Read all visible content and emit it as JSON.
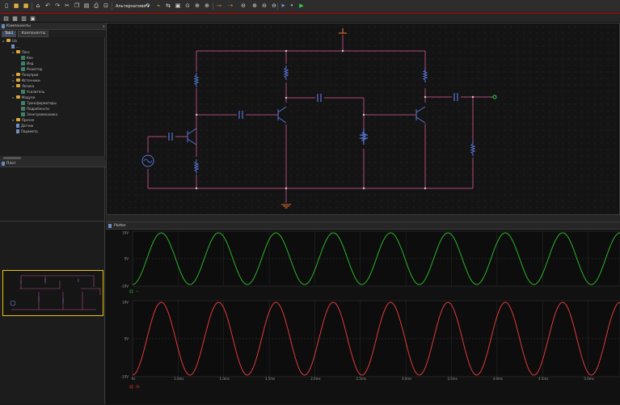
{
  "toolbar": {
    "mode_label": "Альтернатива",
    "icons": [
      "new-file",
      "open-folder",
      "save",
      "save-as",
      "undo",
      "redo",
      "cut",
      "copy",
      "paste",
      "print",
      "zoom-fit",
      "rotate",
      "flip",
      "wire",
      "component",
      "probe",
      "zoom-in",
      "zoom-out",
      "select",
      "run"
    ]
  },
  "left_panel": {
    "title": "Компоненты",
    "tab1": "Tab1",
    "tab2": "Компоненты",
    "tree": [
      {
        "label": "Lib",
        "indent": 0,
        "icon": "folder"
      },
      {
        "label": "...",
        "indent": 1,
        "icon": "file"
      },
      {
        "label": "Пасс",
        "indent": 2,
        "icon": "folder"
      },
      {
        "label": "Кон",
        "indent": 3,
        "icon": "comp"
      },
      {
        "label": "Инд",
        "indent": 3,
        "icon": "comp"
      },
      {
        "label": "Резистор",
        "indent": 3,
        "icon": "comp"
      },
      {
        "label": "Полупров",
        "indent": 2,
        "icon": "folder"
      },
      {
        "label": "Источники",
        "indent": 2,
        "icon": "folder"
      },
      {
        "label": "Логика",
        "indent": 2,
        "icon": "folder"
      },
      {
        "label": "Усилитель",
        "indent": 3,
        "icon": "comp"
      },
      {
        "label": "Модули",
        "indent": 2,
        "icon": "folder"
      },
      {
        "label": "Трансформаторы",
        "indent": 3,
        "icon": "comp"
      },
      {
        "label": "Подробности",
        "indent": 3,
        "icon": "comp"
      },
      {
        "label": "Электромеханика",
        "indent": 3,
        "icon": "comp"
      },
      {
        "label": "Прочее",
        "indent": 2,
        "icon": "folder"
      },
      {
        "label": "Датчик",
        "indent": 2,
        "icon": "file"
      },
      {
        "label": "Параметр",
        "indent": 2,
        "icon": "file"
      }
    ],
    "second_panel_title": "Плот"
  },
  "plot": {
    "window_title": "Plotter",
    "trace1_name": "~",
    "trace2_name": "Ot",
    "top_axis": {
      "ymax": "10V",
      "ymid": "0V",
      "ymin": "-10V"
    },
    "bottom_axis": {
      "ymax": "10V",
      "ymid": "0V",
      "ymin": "-10V"
    },
    "x_ticks": [
      "0s",
      "1.0ms",
      "1.0ms",
      "1.5ms",
      "2.0ms",
      "2.5ms",
      "3.0ms",
      "3.5ms",
      "4.0ms",
      "4.5ms",
      "5.0ms"
    ],
    "colors": {
      "trace1": "#2bb32b",
      "trace2": "#e03a3a"
    }
  }
}
